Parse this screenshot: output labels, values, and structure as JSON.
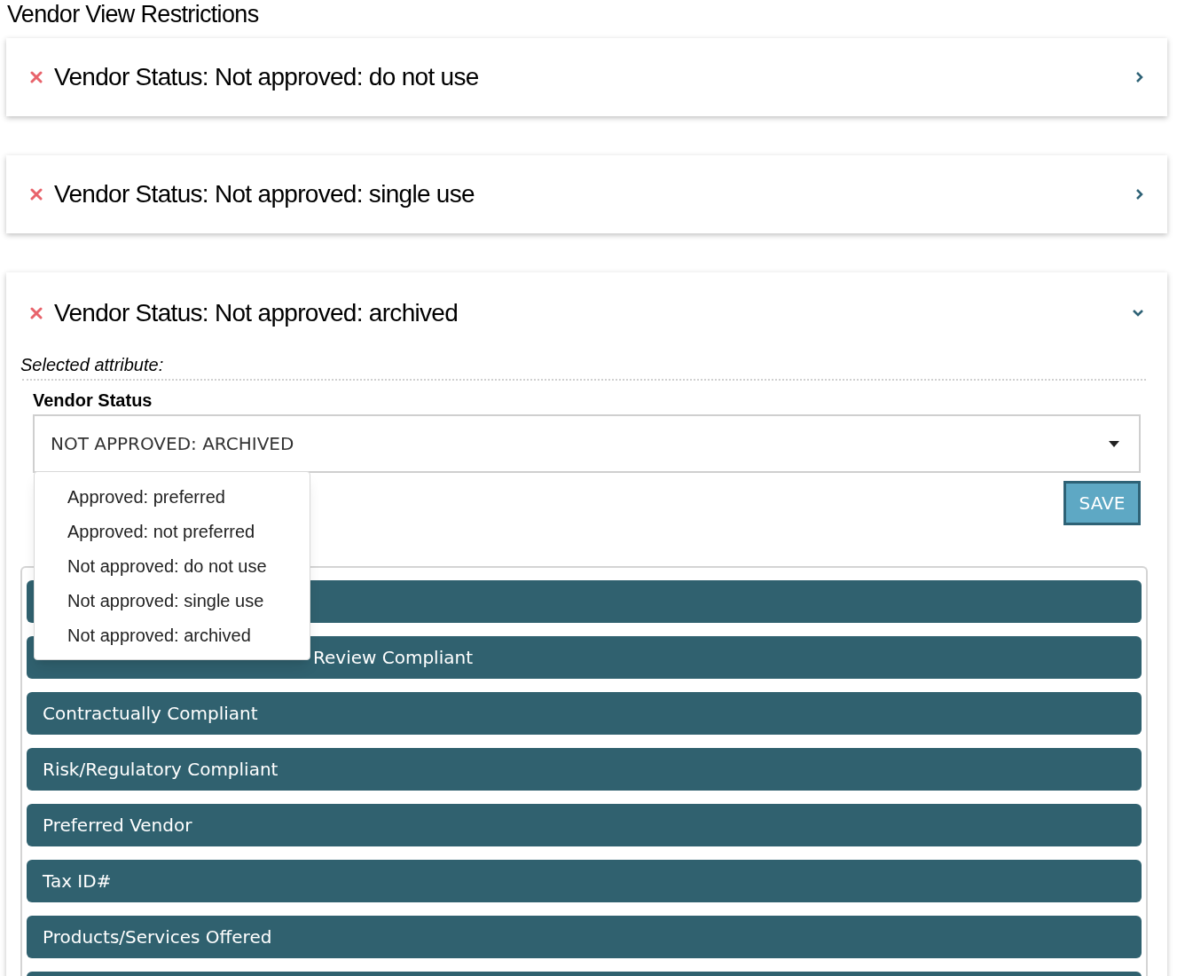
{
  "heading": "Vendor View Restrictions",
  "restrictions": [
    {
      "label": "Vendor Status: Not approved: do not use",
      "expanded": false
    },
    {
      "label": "Vendor Status: Not approved: single use",
      "expanded": false
    },
    {
      "label": "Vendor Status: Not approved: archived",
      "expanded": true
    }
  ],
  "editor": {
    "caption": "Selected attribute:",
    "field_label": "Vendor Status",
    "value": "NOT APPROVED: ARCHIVED",
    "options": [
      "Approved: preferred",
      "Approved: not preferred",
      "Not approved: do not use",
      "Not approved: single use",
      "Not approved: archived"
    ],
    "save": "SAVE"
  },
  "sections": [
    {
      "kind": "covered"
    },
    {
      "kind": "partly_covered",
      "label": "Review Compliant"
    },
    {
      "kind": "bar",
      "label": "Contractually Compliant"
    },
    {
      "kind": "bar",
      "label": "Risk/Regulatory Compliant"
    },
    {
      "kind": "bar",
      "label": "Preferred Vendor"
    },
    {
      "kind": "bar",
      "label": "Tax ID#"
    },
    {
      "kind": "bar",
      "label": "Products/Services Offered"
    },
    {
      "kind": "covered"
    }
  ]
}
